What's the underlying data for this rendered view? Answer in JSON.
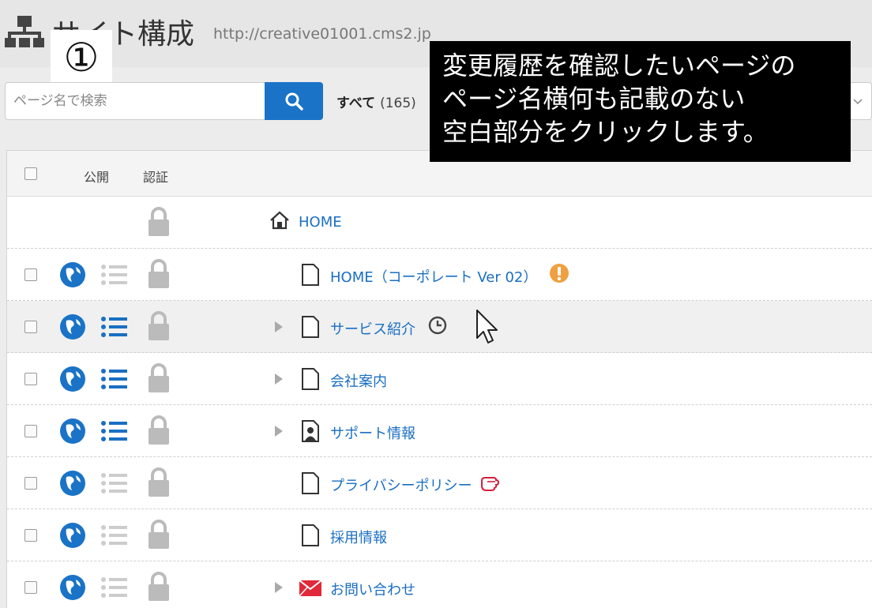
{
  "header": {
    "title": "サイト構成",
    "url": "http://creative01001.cms2.jp",
    "step_number": "①"
  },
  "search": {
    "placeholder": "ページ名で検索"
  },
  "filter": {
    "label": "すべて",
    "count": "(165)"
  },
  "callout": {
    "lines": [
      "変更履歴を確認したいページの",
      "ページ名横何も記載のない",
      "空白部分をクリックします。"
    ]
  },
  "table": {
    "columns": {
      "publish": "公開",
      "auth": "認証"
    },
    "rows": [
      {
        "name": "HOME",
        "type": "home"
      },
      {
        "name": "HOME（コーポレート Ver 02）",
        "type": "page",
        "badge": "warning-icon"
      },
      {
        "name": "サービス紹介",
        "type": "page",
        "badge": "clock-icon",
        "expandable": true,
        "menu_active": true
      },
      {
        "name": "会社案内",
        "type": "page",
        "expandable": true,
        "menu_active": true
      },
      {
        "name": "サポート情報",
        "type": "person-page",
        "expandable": true,
        "menu_active": true
      },
      {
        "name": "プライバシーポリシー",
        "type": "page",
        "badge": "hand-icon"
      },
      {
        "name": "採用情報",
        "type": "page"
      },
      {
        "name": "お問い合わせ",
        "type": "mail",
        "expandable": true
      }
    ]
  },
  "colors": {
    "link": "#1a6fc2",
    "search_button": "#1a73c6",
    "warning": "#f0a040",
    "mail": "#e0293a"
  }
}
